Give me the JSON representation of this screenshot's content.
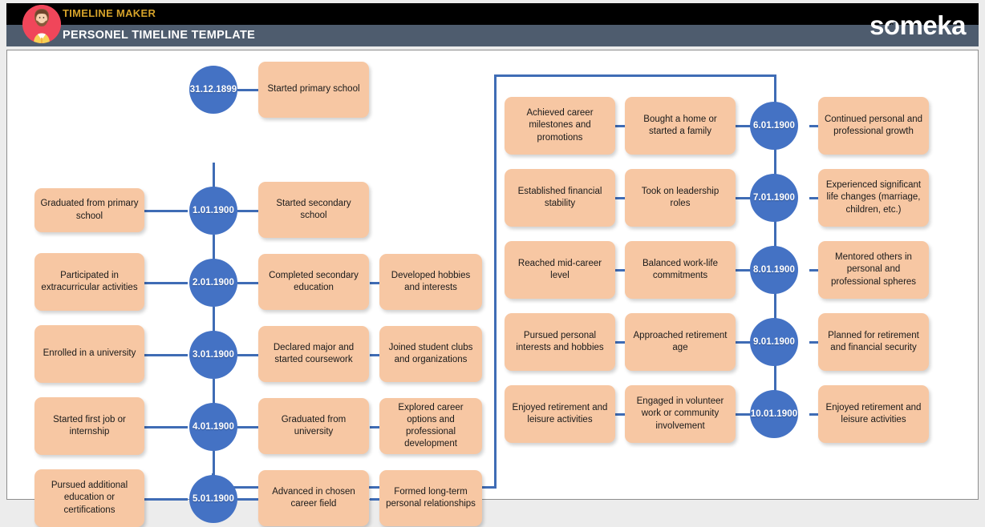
{
  "header": {
    "kicker": "TIMELINE MAKER",
    "title": "PERSONEL TIMELINE TEMPLATE",
    "logo": "someka",
    "logo_letters": {
      "pre": "s",
      "o": "o",
      "post": "meka"
    },
    "colors": {
      "top_band": "#000000",
      "bottom_band": "#4e5c6e",
      "kicker": "#d5a22a",
      "title": "#ffffff"
    }
  },
  "theme": {
    "node_blue": "#4472c4",
    "line_blue": "#3f6cb5",
    "card_peach": "#f7c7a3",
    "canvas_bg": "#ffffff",
    "page_bg": "#ececec"
  },
  "timeline_left": {
    "rows": [
      {
        "date": "31.12.1899",
        "cards": [
          "Started primary school"
        ]
      },
      {
        "date": "1.01.1900",
        "cards_left": [
          "Graduated from primary school"
        ],
        "cards": [
          "Started secondary school"
        ]
      },
      {
        "date": "2.01.1900",
        "cards_left": [
          "Participated in extracurricular activities"
        ],
        "cards": [
          "Completed secondary education",
          "Developed hobbies and interests"
        ]
      },
      {
        "date": "3.01.1900",
        "cards_left": [
          "Enrolled in a university"
        ],
        "cards": [
          "Declared major and started coursework",
          "Joined student clubs and organizations"
        ]
      },
      {
        "date": "4.01.1900",
        "cards_left": [
          "Started first job or internship"
        ],
        "cards": [
          "Graduated from university",
          "Explored career options and professional development"
        ]
      },
      {
        "date": "5.01.1900",
        "cards_left": [
          "Pursued additional education or certifications"
        ],
        "cards": [
          "Advanced in chosen career field",
          "Formed long-term personal relationships"
        ]
      }
    ]
  },
  "timeline_right": {
    "rows": [
      {
        "date": "6.01.1900",
        "cards_left": [
          "Achieved career milestones and promotions",
          "Bought a home or started a family"
        ],
        "cards": [
          "Continued personal and professional growth"
        ]
      },
      {
        "date": "7.01.1900",
        "cards_left": [
          "Established financial stability",
          "Took on leadership roles"
        ],
        "cards": [
          "Experienced significant life changes (marriage, children, etc.)"
        ]
      },
      {
        "date": "8.01.1900",
        "cards_left": [
          "Reached mid-career level",
          "Balanced work-life commitments"
        ],
        "cards": [
          "Mentored others in personal and professional spheres"
        ]
      },
      {
        "date": "9.01.1900",
        "cards_left": [
          "Pursued personal interests and hobbies",
          "Approached retirement age"
        ],
        "cards": [
          "Planned for retirement and financial security"
        ]
      },
      {
        "date": "10.01.1900",
        "cards_left": [
          "Enjoyed retirement and leisure activities",
          "Engaged in volunteer work or community involvement"
        ],
        "cards": [
          "Enjoyed retirement and leisure activities"
        ]
      }
    ]
  }
}
